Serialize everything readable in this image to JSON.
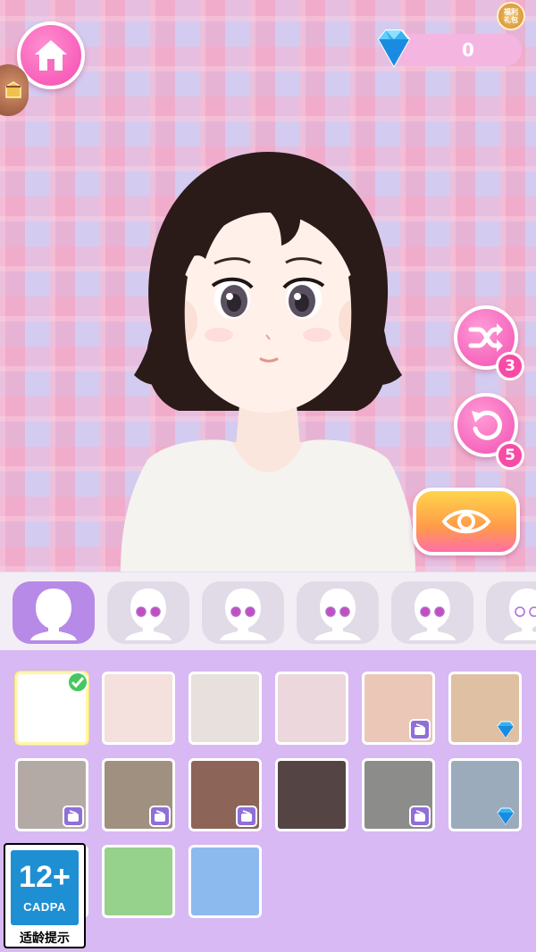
{
  "currency": {
    "gem_count": "0",
    "icon": "diamond-icon"
  },
  "top_badge": {
    "text": "福利\n礼包"
  },
  "buttons": {
    "home": {
      "icon": "home-icon"
    },
    "shuffle": {
      "icon": "shuffle-icon",
      "count": "3"
    },
    "undo": {
      "icon": "undo-icon",
      "count": "5"
    },
    "preview": {
      "icon": "eye-icon"
    }
  },
  "part_tabs": [
    {
      "name": "face-shape",
      "icon": "head-silhouette-icon",
      "active": true
    },
    {
      "name": "eyes-1",
      "icon": "eyes-icon",
      "active": false
    },
    {
      "name": "eyes-2",
      "icon": "eyes-icon",
      "active": false
    },
    {
      "name": "eyes-3",
      "icon": "eyes-icon",
      "active": false
    },
    {
      "name": "eyes-4",
      "icon": "eyes-icon",
      "active": false
    },
    {
      "name": "eyes-5",
      "icon": "eyes-icon",
      "active": false
    }
  ],
  "colors": [
    {
      "hex": "#ffffff",
      "selected": true,
      "lock": "none"
    },
    {
      "hex": "#f4e0dc",
      "selected": false,
      "lock": "none"
    },
    {
      "hex": "#e8e0dc",
      "selected": false,
      "lock": "none"
    },
    {
      "hex": "#ecd8dc",
      "selected": false,
      "lock": "none"
    },
    {
      "hex": "#ebc7b8",
      "selected": false,
      "lock": "ad"
    },
    {
      "hex": "#e0c0a2",
      "selected": false,
      "lock": "gem"
    },
    {
      "hex": "#b4aaa5",
      "selected": false,
      "lock": "ad"
    },
    {
      "hex": "#a09080",
      "selected": false,
      "lock": "ad"
    },
    {
      "hex": "#8c6458",
      "selected": false,
      "lock": "ad"
    },
    {
      "hex": "#544444",
      "selected": false,
      "lock": "none"
    },
    {
      "hex": "#8c8c8a",
      "selected": false,
      "lock": "ad"
    },
    {
      "hex": "#9cabbc",
      "selected": false,
      "lock": "gem"
    },
    {
      "hex": "#e06464",
      "selected": false,
      "lock": "none"
    },
    {
      "hex": "#96d28c",
      "selected": false,
      "lock": "none"
    },
    {
      "hex": "#8cbaee",
      "selected": false,
      "lock": "none"
    }
  ],
  "age_rating": {
    "number": "12+",
    "org": "CADPA",
    "tip": "适龄提示"
  }
}
